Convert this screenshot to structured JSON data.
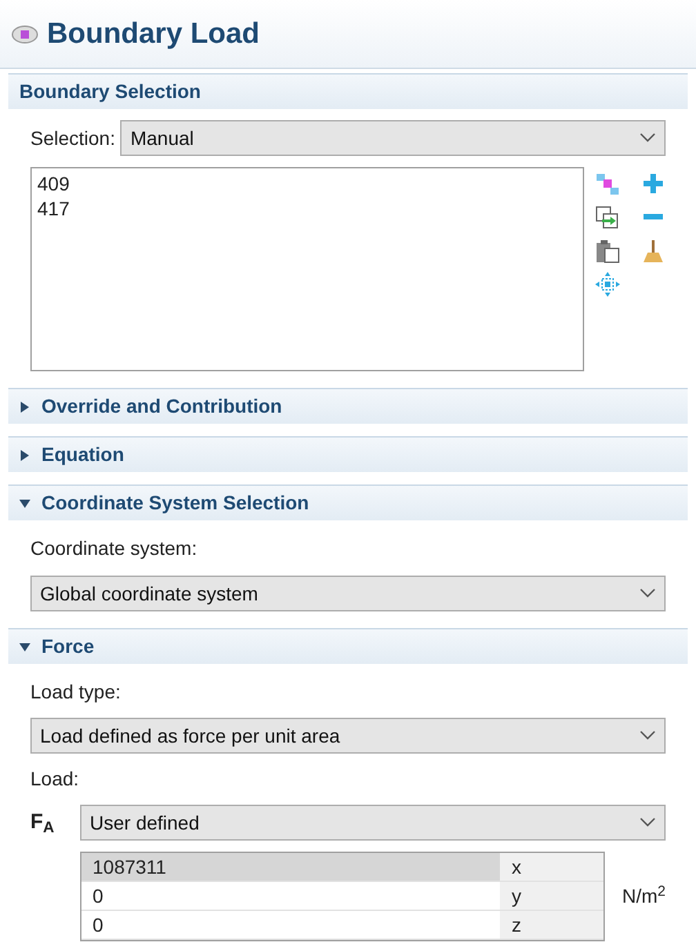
{
  "title": "Boundary Load",
  "sections": [
    {
      "kind": "static",
      "title": "Boundary Selection",
      "body": {
        "kind": "selection",
        "label": "Selection:",
        "value": "Manual",
        "items": [
          "409",
          "417"
        ]
      }
    },
    {
      "kind": "collapsible",
      "title": "Override and Contribution",
      "expanded": false
    },
    {
      "kind": "collapsible",
      "title": "Equation",
      "expanded": false
    },
    {
      "kind": "collapsible",
      "title": "Coordinate System Selection",
      "expanded": true,
      "body": {
        "kind": "coord",
        "label": "Coordinate system:",
        "value": "Global coordinate system"
      }
    },
    {
      "kind": "collapsible",
      "title": "Force",
      "expanded": true,
      "body": {
        "kind": "force",
        "load_type_label": "Load type:",
        "load_type": "Load defined as force per unit area",
        "load_label": "Load:",
        "symbol": "F$_{A}$",
        "mode": "User defined",
        "unit": "N/m$^{2}$",
        "rows": [
          {
            "value": "1087311",
            "component": "x",
            "selected": true
          },
          {
            "value": "0",
            "component": "y",
            "selected": false
          },
          {
            "value": "0",
            "component": "z",
            "selected": false
          }
        ]
      }
    }
  ]
}
